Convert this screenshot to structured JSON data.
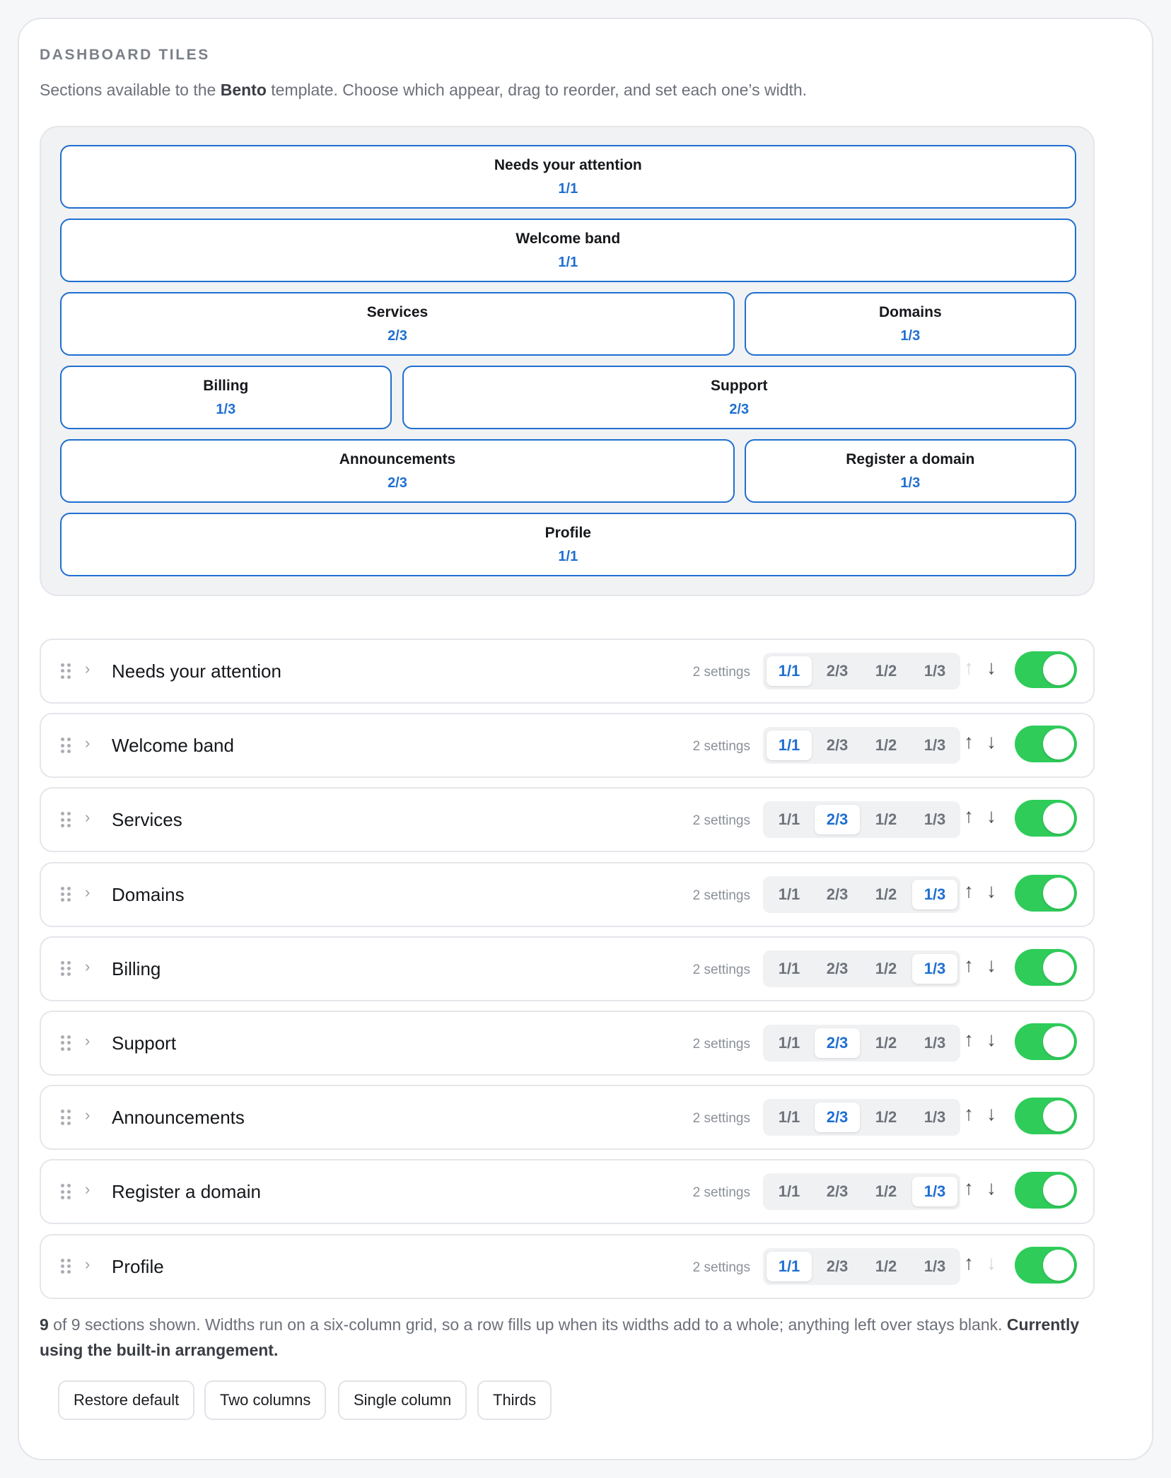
{
  "header": {
    "title": "DASHBOARD TILES",
    "desc_before": "Sections available to the ",
    "desc_bold": "Bento",
    "desc_after": " template. Choose which appear, drag to reorder, and set each one’s width."
  },
  "preview": [
    {
      "name": "Needs your attention",
      "width": "1/1"
    },
    {
      "name": "Welcome band",
      "width": "1/1"
    },
    {
      "name": "Services",
      "width": "2/3"
    },
    {
      "name": "Domains",
      "width": "1/3"
    },
    {
      "name": "Billing",
      "width": "1/3"
    },
    {
      "name": "Support",
      "width": "2/3"
    },
    {
      "name": "Announcements",
      "width": "2/3"
    },
    {
      "name": "Register a domain",
      "width": "1/3"
    },
    {
      "name": "Profile",
      "width": "1/1"
    }
  ],
  "width_options": [
    "1/1",
    "2/3",
    "1/2",
    "1/3"
  ],
  "tiles": [
    {
      "name": "Needs your attention",
      "settings": "2 settings",
      "width": "1/1",
      "up_enabled": false,
      "down_enabled": true,
      "enabled": true
    },
    {
      "name": "Welcome band",
      "settings": "2 settings",
      "width": "1/1",
      "up_enabled": true,
      "down_enabled": true,
      "enabled": true
    },
    {
      "name": "Services",
      "settings": "2 settings",
      "width": "2/3",
      "up_enabled": true,
      "down_enabled": true,
      "enabled": true
    },
    {
      "name": "Domains",
      "settings": "2 settings",
      "width": "1/3",
      "up_enabled": true,
      "down_enabled": true,
      "enabled": true
    },
    {
      "name": "Billing",
      "settings": "2 settings",
      "width": "1/3",
      "up_enabled": true,
      "down_enabled": true,
      "enabled": true
    },
    {
      "name": "Support",
      "settings": "2 settings",
      "width": "2/3",
      "up_enabled": true,
      "down_enabled": true,
      "enabled": true
    },
    {
      "name": "Announcements",
      "settings": "2 settings",
      "width": "2/3",
      "up_enabled": true,
      "down_enabled": true,
      "enabled": true
    },
    {
      "name": "Register a domain",
      "settings": "2 settings",
      "width": "1/3",
      "up_enabled": true,
      "down_enabled": true,
      "enabled": true
    },
    {
      "name": "Profile",
      "settings": "2 settings",
      "width": "1/1",
      "up_enabled": true,
      "down_enabled": false,
      "enabled": true
    }
  ],
  "icons": {
    "chevron": "›",
    "up_arrow": "↑",
    "down_arrow": "↓"
  },
  "summary": {
    "shown_count": "9",
    "text": " of 9 sections shown. Widths run on a six-column grid, so a row fills up when its widths add to a whole; anything left over stays blank. ",
    "status_bold": "Currently using the built-in arrangement."
  },
  "presets": [
    "Restore default",
    "Two columns",
    "Single column",
    "Thirds"
  ],
  "colors": {
    "accent": "#1f6fd1",
    "toggle_on": "#2fcc5a"
  }
}
